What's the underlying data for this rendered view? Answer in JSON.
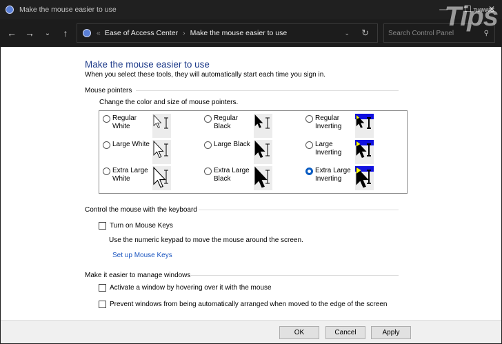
{
  "window": {
    "title": "Make the mouse easier to use",
    "watermark": "Tips THAIWARE"
  },
  "nav": {
    "breadcrumb": [
      "Ease of Access Center",
      "Make the mouse easier to use"
    ],
    "search_placeholder": "Search Control Panel"
  },
  "page": {
    "title": "Make the mouse easier to use",
    "subtitle": "When you select these tools, they will automatically start each time you sign in."
  },
  "pointers": {
    "section": "Mouse pointers",
    "desc": "Change the color and size of mouse pointers.",
    "options": [
      {
        "label": "Regular White",
        "style": "white",
        "size": "regular",
        "selected": false
      },
      {
        "label": "Regular Black",
        "style": "black",
        "size": "regular",
        "selected": false
      },
      {
        "label": "Regular Inverting",
        "style": "invert",
        "size": "regular",
        "selected": false
      },
      {
        "label": "Large White",
        "style": "white",
        "size": "large",
        "selected": false
      },
      {
        "label": "Large Black",
        "style": "black",
        "size": "large",
        "selected": false
      },
      {
        "label": "Large Inverting",
        "style": "invert",
        "size": "large",
        "selected": false
      },
      {
        "label": "Extra Large White",
        "style": "white",
        "size": "xl",
        "selected": false
      },
      {
        "label": "Extra Large Black",
        "style": "black",
        "size": "xl",
        "selected": false
      },
      {
        "label": "Extra Large Inverting",
        "style": "invert",
        "size": "xl",
        "selected": true
      }
    ]
  },
  "keyboard": {
    "section": "Control the mouse with the keyboard",
    "mouse_keys": "Turn on Mouse Keys",
    "mouse_keys_checked": false,
    "desc": "Use the numeric keypad to move the mouse around the screen.",
    "link": "Set up Mouse Keys"
  },
  "windows": {
    "section": "Make it easier to manage windows",
    "hover": "Activate a window by hovering over it with the mouse",
    "hover_checked": false,
    "snap": "Prevent windows from being automatically arranged when moved to the edge of the screen",
    "snap_checked": false
  },
  "buttons": {
    "ok": "OK",
    "cancel": "Cancel",
    "apply": "Apply"
  },
  "colors": {
    "accent": "#0a5cc2",
    "title": "#1e3b8a",
    "link": "#1a55c0"
  }
}
